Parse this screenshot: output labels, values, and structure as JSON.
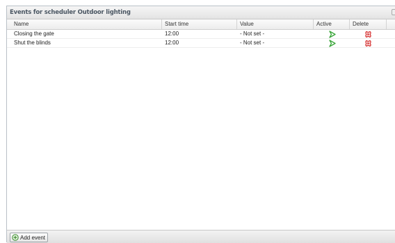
{
  "panel": {
    "title": "Events for scheduler Outdoor lighting"
  },
  "grid": {
    "columns": [
      "Name",
      "Start time",
      "Value",
      "Active",
      "Delete"
    ],
    "rows": [
      {
        "name": "Closing the gate",
        "start_time": "12:00",
        "value": "- Not set -",
        "active_icon": "play-arrow-icon",
        "delete_icon": "delete-icon"
      },
      {
        "name": "Shut the blinds",
        "start_time": "12:00",
        "value": "- Not set -",
        "active_icon": "play-arrow-icon",
        "delete_icon": "delete-icon"
      }
    ]
  },
  "footer": {
    "add_label": "Add event"
  },
  "colors": {
    "active_green": "#3aa53a",
    "delete_red": "#d42a2a",
    "header_text": "#4a5662"
  }
}
